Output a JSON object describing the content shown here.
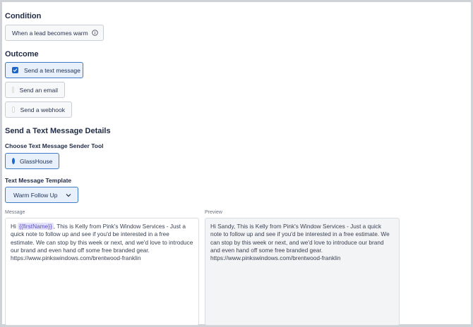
{
  "condition": {
    "title": "Condition",
    "trigger_label": "When a lead becomes warm",
    "info_icon": "info-icon"
  },
  "outcome": {
    "title": "Outcome",
    "options": [
      {
        "label": "Send a text message",
        "checked": true
      },
      {
        "label": "Send an email",
        "checked": false
      },
      {
        "label": "Send a webhook",
        "checked": false
      }
    ]
  },
  "details": {
    "title": "Send a Text Message Details",
    "sender_label": "Choose Text Message Sender Tool",
    "sender_option": "GlassHouse",
    "template_label": "Text Message Template",
    "template_value": "Warm Follow Up"
  },
  "message": {
    "label": "Message",
    "greeting": "Hi",
    "token": "{{firstName}}",
    "body": ", This is Kelly from Pink's Window Services - Just a quick note to follow up and see if you'd be interested in a free estimate. We can stop by this week or next, and we'd love to introduce our brand and even hand off some free branded gear. https://www.pinkswindows.com/brentwood-franklin"
  },
  "preview": {
    "label": "Preview",
    "text": "Hi Sandy, This is Kelly from Pink's Window Services - Just a quick note to follow up and see if you'd be interested in a free estimate. We can stop by this week or next, and we'd love to introduce our brand and even hand off some free branded gear. https://www.pinkswindows.com/brentwood-franklin"
  },
  "colors": {
    "accent": "#1d67c9",
    "selected_bg": "#e7f0fb",
    "token_bg": "#e4e1fb",
    "token_text": "#5b50c9",
    "heading": "#1f2a44"
  }
}
